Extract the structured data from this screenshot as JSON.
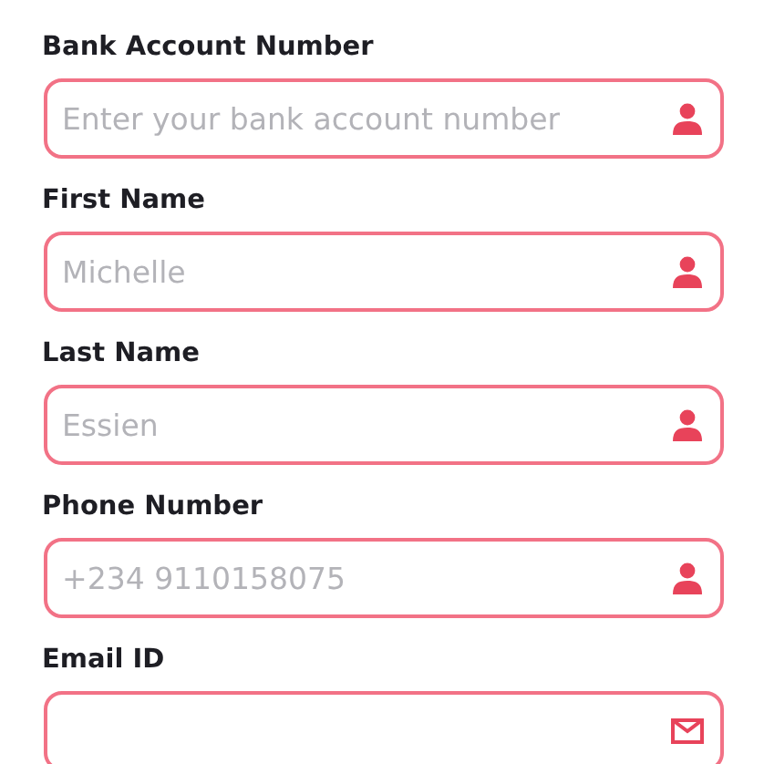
{
  "fields": [
    {
      "label": "Bank Account Number",
      "placeholder": "Enter your bank account number",
      "kind": "person"
    },
    {
      "label": "First Name",
      "placeholder": "Michelle",
      "kind": "person"
    },
    {
      "label": "Last Name",
      "placeholder": "Essien",
      "kind": "person"
    },
    {
      "label": "Phone Number",
      "placeholder": "+234 9110158075",
      "kind": "person"
    },
    {
      "label": "Email ID",
      "kind": "mail"
    }
  ]
}
